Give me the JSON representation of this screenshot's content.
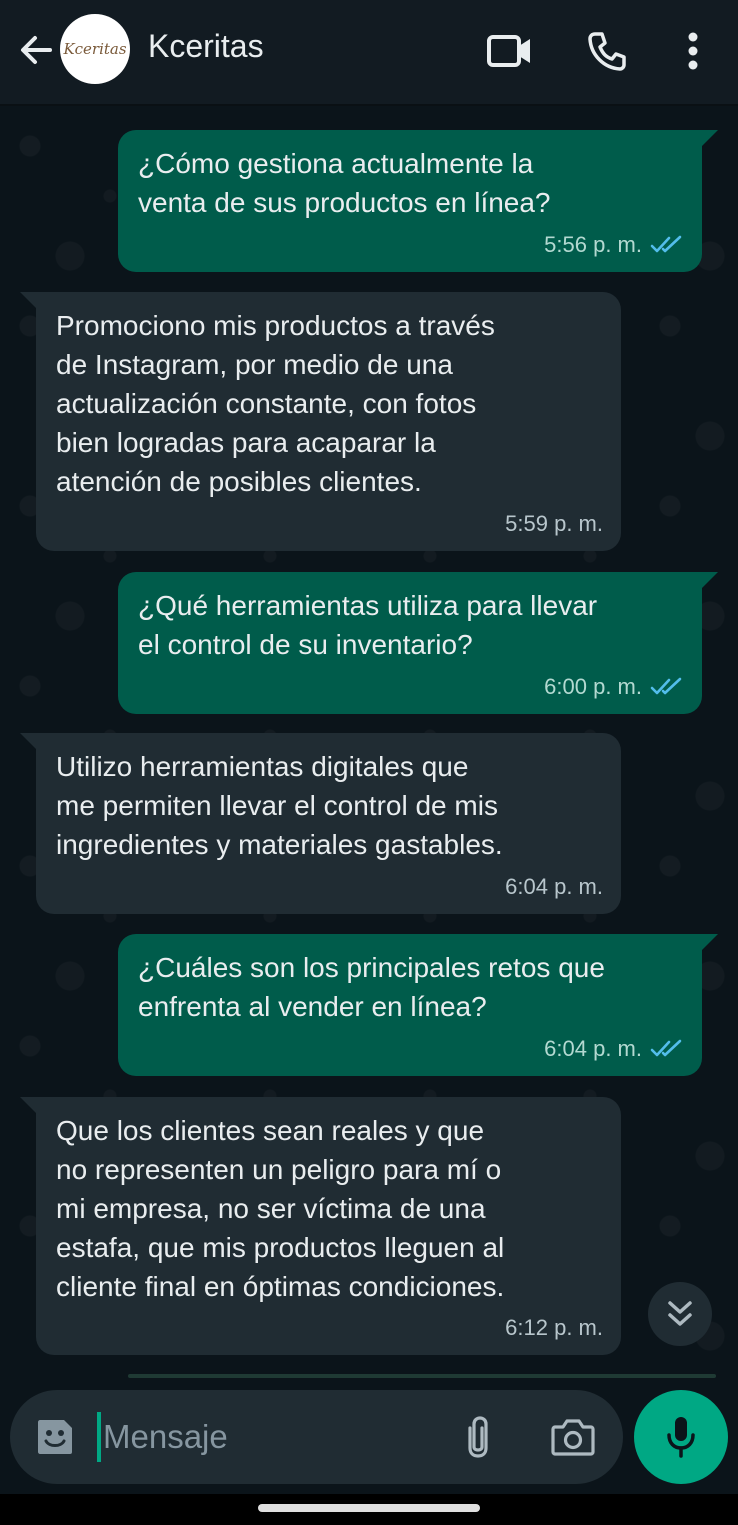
{
  "header": {
    "contact_name": "Kceritas",
    "avatar_text": "Kceritas",
    "icons": [
      "back-arrow-icon",
      "video-call-icon",
      "voice-call-icon",
      "more-options-icon"
    ]
  },
  "messages": [
    {
      "direction": "outgoing",
      "text": "¿Cómo gestiona actualmente la\nventa de sus  productos en línea?",
      "time": "5:56 p. m.",
      "status": "read"
    },
    {
      "direction": "incoming",
      "text": "Promociono mis productos a través\nde Instagram, por medio de una\nactualización constante, con fotos\nbien logradas para acaparar la\natención de posibles clientes.",
      "time": "5:59 p. m."
    },
    {
      "direction": "outgoing",
      "text": "¿Qué herramientas utiliza para llevar\nel control de su inventario?",
      "time": "6:00 p. m.",
      "status": "read"
    },
    {
      "direction": "incoming",
      "text": "Utilizo herramientas digitales que\nme permiten llevar el control de mis\ningredientes y materiales gastables.",
      "time": "6:04 p. m."
    },
    {
      "direction": "outgoing",
      "text": "¿Cuáles son los principales retos que\nenfrenta al vender en línea?",
      "time": "6:04 p. m.",
      "status": "read"
    },
    {
      "direction": "incoming",
      "text": "Que los clientes sean reales y que\nno representen un peligro para mí o\nmi empresa, no ser víctima de una\nestafa, que mis productos lleguen al\ncliente final en óptimas condiciones.",
      "time": "6:12 p. m."
    }
  ],
  "composer": {
    "placeholder": "Mensaje",
    "icons": [
      "emoji-icon",
      "attach-icon",
      "camera-icon",
      "mic-icon"
    ]
  },
  "colors": {
    "background": "#0b141a",
    "header": "#121b22",
    "outgoing_bubble": "#005c4b",
    "incoming_bubble": "#202c33",
    "accent": "#00a884",
    "read_tick": "#53bdeb"
  }
}
